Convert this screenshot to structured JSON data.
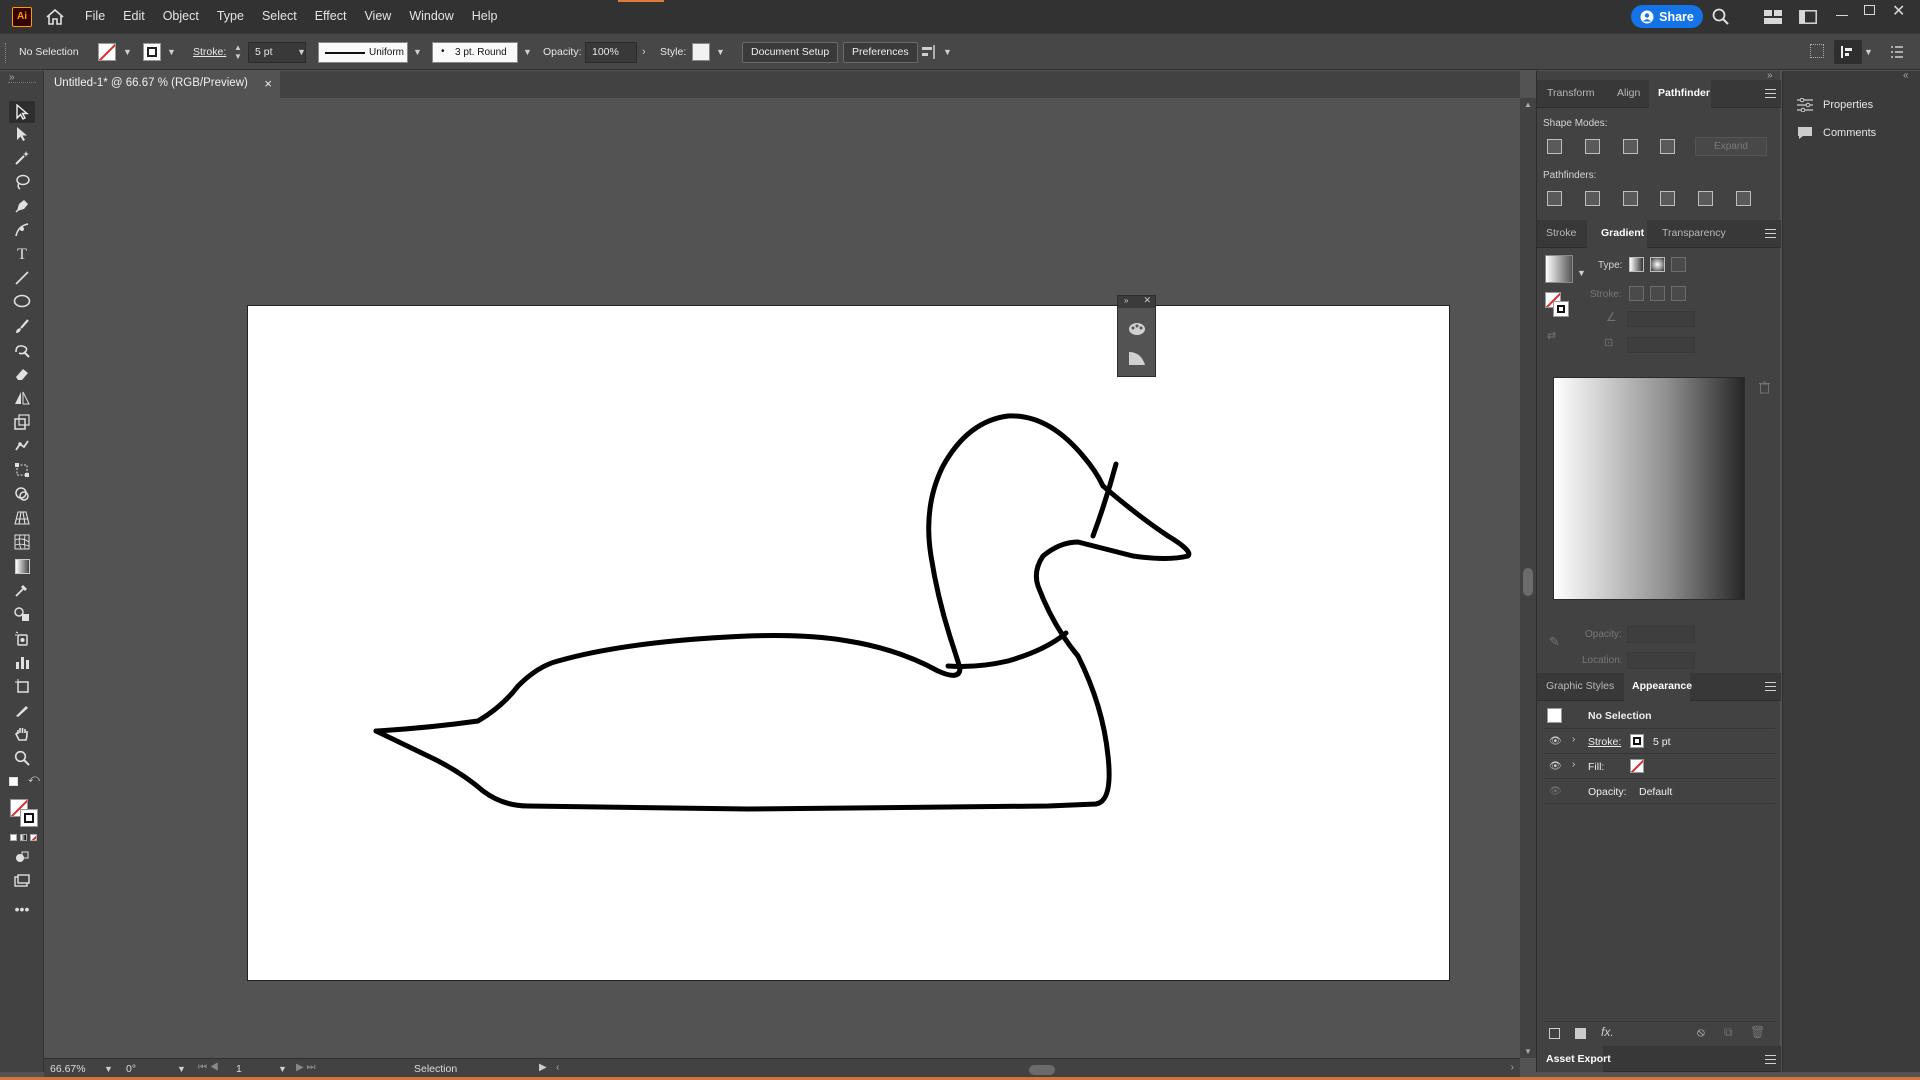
{
  "app": {
    "logo": "Ai"
  },
  "menubar": {
    "items": [
      "File",
      "Edit",
      "Object",
      "Type",
      "Select",
      "Effect",
      "View",
      "Window",
      "Help"
    ],
    "share_label": "Share"
  },
  "controlbar": {
    "selection": "No Selection",
    "stroke_label": "Stroke:",
    "stroke_value": "5 pt",
    "profile": "Uniform",
    "brush": "3 pt. Round",
    "opacity_label": "Opacity:",
    "opacity_value": "100%",
    "style_label": "Style:",
    "document_setup": "Document Setup",
    "preferences": "Preferences"
  },
  "document": {
    "tab_title": "Untitled-1* @ 66.67 % (RGB/Preview)",
    "close": "×"
  },
  "statusbar": {
    "zoom": "66.67%",
    "rotation": "0°",
    "artboard": "1",
    "tool": "Selection"
  },
  "pathfinder_panel": {
    "tabs": [
      "Transform",
      "Align",
      "Pathfinder"
    ],
    "active": "Pathfinder",
    "shape_modes_label": "Shape Modes:",
    "expand": "Expand",
    "pathfinders_label": "Pathfinders:"
  },
  "gradient_panel": {
    "tabs": [
      "Stroke",
      "Gradient",
      "Transparency"
    ],
    "active": "Gradient",
    "type_label": "Type:",
    "stroke_label": "Stroke:",
    "opacity_label": "Opacity:",
    "location_label": "Location:"
  },
  "appearance_panel": {
    "tabs": [
      "Graphic Styles",
      "Appearance"
    ],
    "active": "Appearance",
    "title": "No Selection",
    "stroke_label": "Stroke:",
    "stroke_value": "5 pt",
    "fill_label": "Fill:",
    "opacity_label": "Opacity:",
    "opacity_value": "Default",
    "fx": "fx."
  },
  "asset_export": {
    "label": "Asset Export"
  },
  "side_panels": {
    "properties": "Properties",
    "comments": "Comments"
  },
  "colors": {
    "accent": "#1473e6",
    "logo_border": "#ff9a00"
  }
}
